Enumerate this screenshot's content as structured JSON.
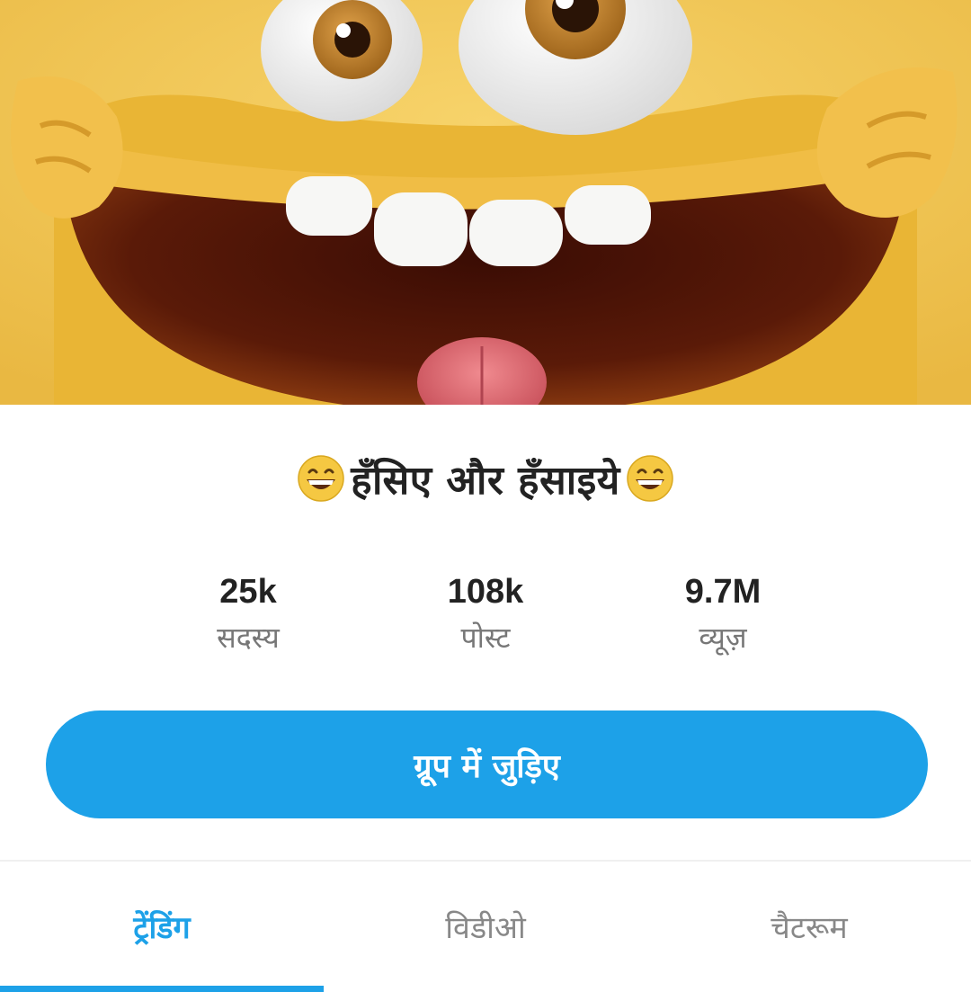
{
  "group": {
    "title": "हँसिए और हँसाइये",
    "title_emoji_left": "grinning-face-icon",
    "title_emoji_right": "grinning-face-icon"
  },
  "stats": [
    {
      "value": "25k",
      "label": "सदस्य"
    },
    {
      "value": "108k",
      "label": "पोस्ट"
    },
    {
      "value": "9.7M",
      "label": "व्यूज़"
    }
  ],
  "join_button": {
    "label": "ग्रूप में जुड़िए"
  },
  "tabs": [
    {
      "label": "ट्रेंडिंग",
      "active": true
    },
    {
      "label": "विडीओ",
      "active": false
    },
    {
      "label": "चैटरूम",
      "active": false
    }
  ],
  "colors": {
    "accent": "#1da1e8",
    "cover_yellow": "#f2c544"
  }
}
